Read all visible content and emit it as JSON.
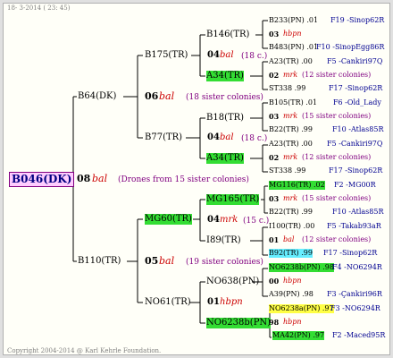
{
  "header": {
    "date": "18- 3-2014 ( 23: 45)"
  },
  "footer": {
    "copyright": "Copyright 2004-2014 @ Karl Kehrle Foundation."
  },
  "root": {
    "id": "B046(DK)"
  },
  "gen2": {
    "b64": "B64(DK)",
    "b110": "B110(TR)",
    "year": "08",
    "breed": "bal",
    "drones_note": "(Drones from 15 sister colonies)"
  },
  "gen3": {
    "b175": "B175(TR)",
    "b77": "B77(TR)",
    "mg60": "MG60(TR)",
    "no61": "NO61(TR)",
    "m1": {
      "year": "06",
      "breed": "bal",
      "note": "(18 sister colonies)"
    },
    "m2": {
      "year": "05",
      "breed": "bal",
      "note": "(19 sister colonies)"
    }
  },
  "gen4": {
    "b146": "B146(TR)",
    "a34a": "A34(TR)",
    "b18": "B18(TR)",
    "a34b": "A34(TR)",
    "mg165": "MG165(TR)",
    "i89": "I89(TR)",
    "no638": "NO638(PN)",
    "no6238b": "NO6238b(PN)",
    "m1": {
      "year": "04",
      "breed": "bal",
      "note": "(18 c.)"
    },
    "m2": {
      "year": "04",
      "breed": "bal",
      "note": "(18 c.)"
    },
    "m3": {
      "year": "04",
      "breed": "mrk",
      "note": "(15 c.)"
    },
    "m4": {
      "year": "01",
      "breed": "hbpn"
    }
  },
  "gen5": {
    "r1": {
      "id": "B233(PN) .01",
      "f": "F19 -Sinop62R"
    },
    "m1": {
      "year": "03",
      "breed": "hbpn"
    },
    "r2": {
      "id": "B483(PN) .01",
      "f": "F10 -SinopEgg86R"
    },
    "r3": {
      "id": "A23(TR) .00",
      "f": "F5 -Cankiri97Q"
    },
    "m2": {
      "year": "02",
      "breed": "mrk",
      "note": "(12 sister colonies)"
    },
    "r4": {
      "id": "ST338 .99",
      "f": "F17 -Sinop62R"
    },
    "r5": {
      "id": "B105(TR) .01",
      "f": "F6 -Old_Lady"
    },
    "m3": {
      "year": "03",
      "breed": "mrk",
      "note": "(15 sister colonies)"
    },
    "r6": {
      "id": "B22(TR) .99",
      "f": "F10 -Atlas85R"
    },
    "r7": {
      "id": "A23(TR) .00",
      "f": "F5 -Cankiri97Q"
    },
    "m4": {
      "year": "02",
      "breed": "mrk",
      "note": "(12 sister colonies)"
    },
    "r8": {
      "id": "ST338 .99",
      "f": "F17 -Sinop62R"
    },
    "r9": {
      "id": "MG116(TR) .02",
      "f": "F2 -MG00R"
    },
    "m5": {
      "year": "03",
      "breed": "mrk",
      "note": "(15 sister colonies)"
    },
    "r10": {
      "id": "B22(TR) .99",
      "f": "F10 -Atlas85R"
    },
    "r11": {
      "id": "I100(TR) .00",
      "f": "F5 -Takab93aR"
    },
    "m6": {
      "year": "01",
      "breed": "bal",
      "note": "(12 sister colonies)"
    },
    "r12": {
      "id": "B92(TR) .99",
      "f": "F17 -Sinop62R"
    },
    "r13": {
      "id": "NO6238b(PN) .98",
      "f": "F4 -NO6294R"
    },
    "m7": {
      "year": "00",
      "breed": "hbpn"
    },
    "r14": {
      "id": "A39(PN) .98",
      "f": "F3 -Çankiri96R"
    },
    "r15": {
      "id": "NO6238a(PN) .97",
      "f": "F3 -NO6294R"
    },
    "m8": {
      "year": "98",
      "breed": "hbpn"
    },
    "r16": {
      "id": "MA42(PN) .97",
      "f": "F2 -Maced95R"
    }
  }
}
